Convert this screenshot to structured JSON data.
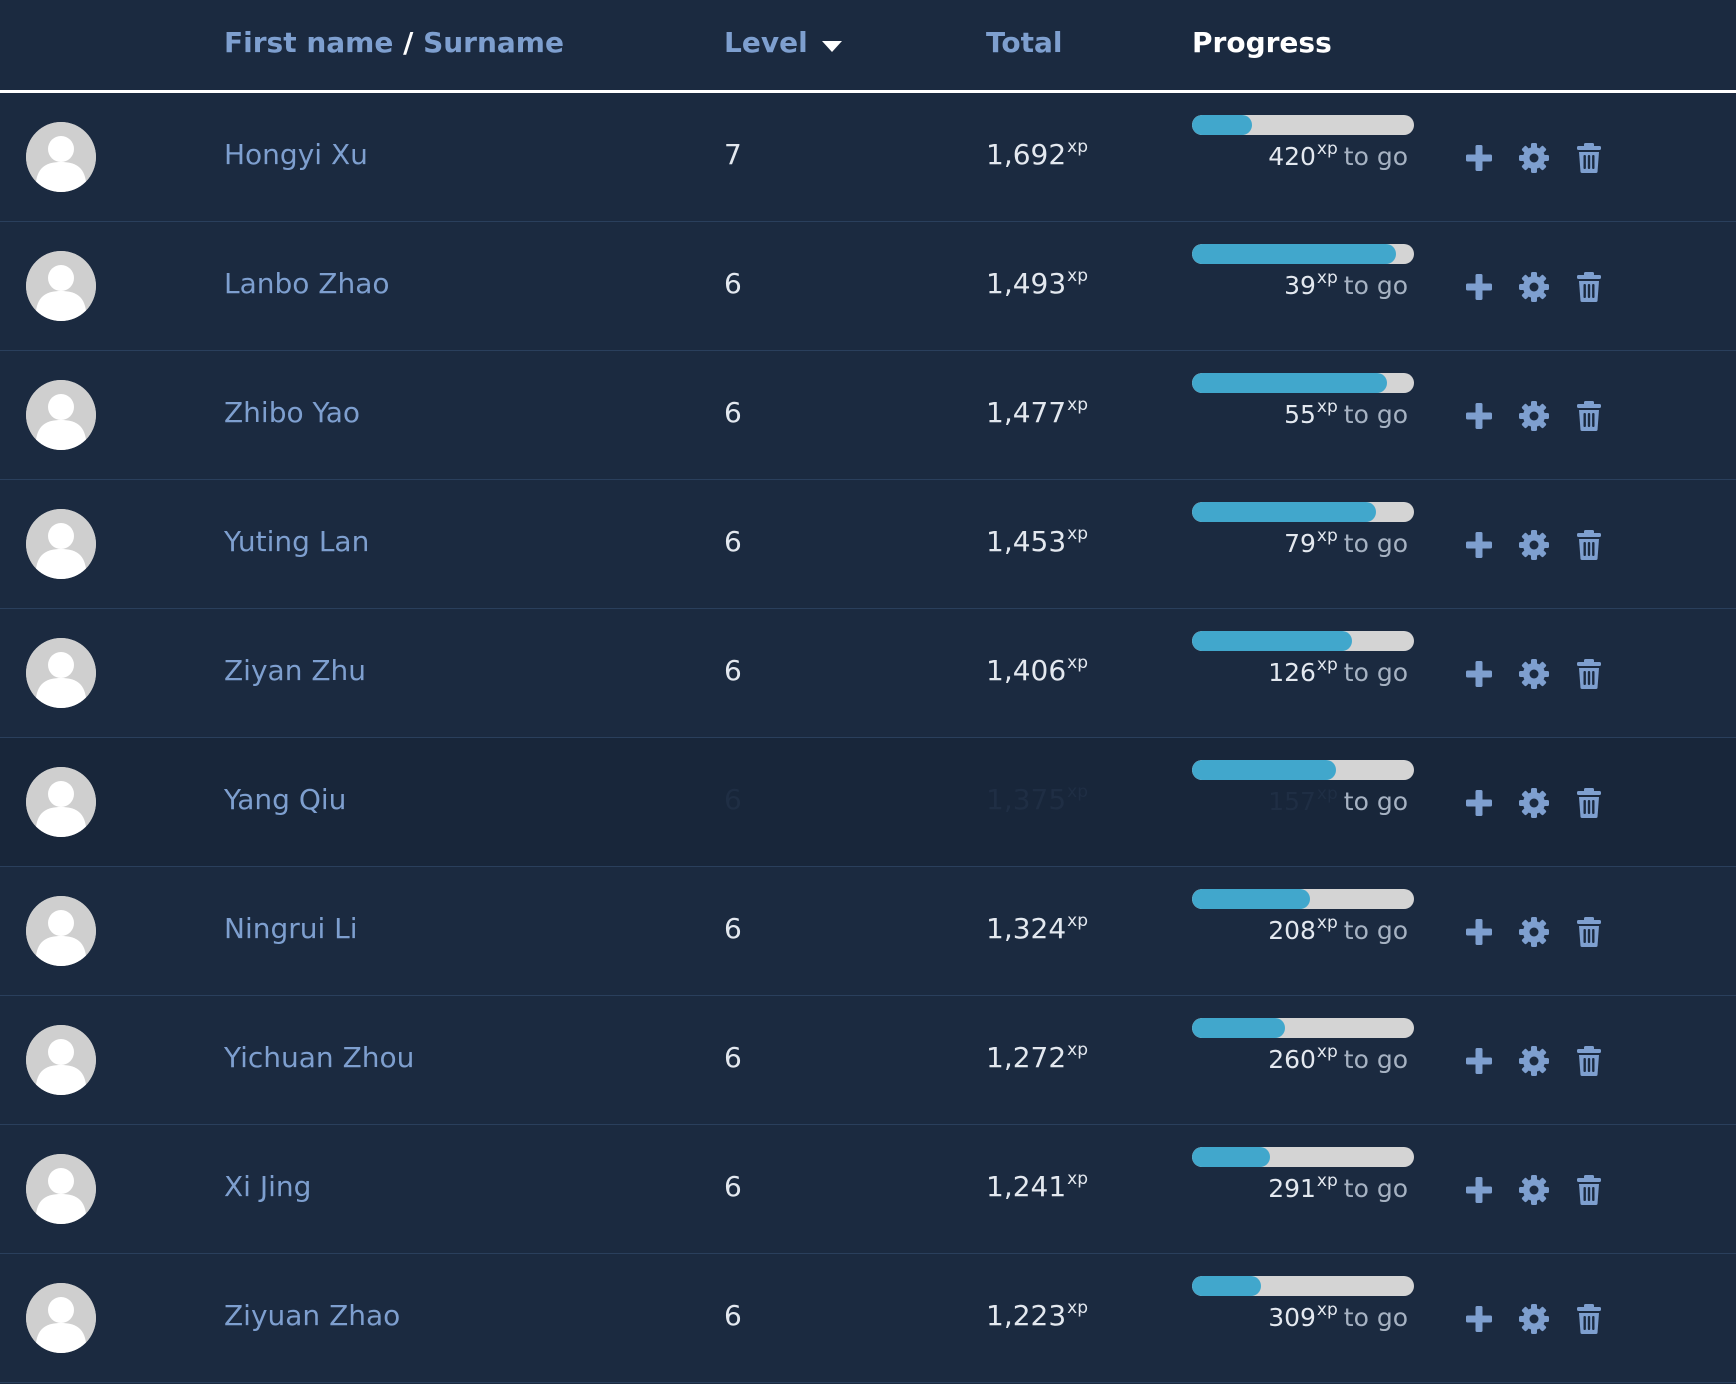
{
  "header": {
    "first_name": "First name",
    "slash": " / ",
    "surname": "Surname",
    "level": "Level",
    "total": "Total",
    "progress": "Progress"
  },
  "units": {
    "xp": "xp",
    "to_go": "to go"
  },
  "colors": {
    "background": "#1b2a40",
    "accent": "#7e9fcf",
    "bar_fill": "#41a7cc",
    "bar_track": "#d4d4d4"
  },
  "icons": {
    "sort": "caret-down-icon",
    "avatar": "user-avatar-icon",
    "add": "plus-icon",
    "settings": "gear-icon",
    "delete": "trash-icon"
  },
  "rows": [
    {
      "name": "Hongyi Xu",
      "level": "7",
      "total": "1,692",
      "remaining": "420",
      "progress": 0.27
    },
    {
      "name": "Lanbo Zhao",
      "level": "6",
      "total": "1,493",
      "remaining": "39",
      "progress": 0.92
    },
    {
      "name": "Zhibo Yao",
      "level": "6",
      "total": "1,477",
      "remaining": "55",
      "progress": 0.88
    },
    {
      "name": "Yuting Lan",
      "level": "6",
      "total": "1,453",
      "remaining": "79",
      "progress": 0.83
    },
    {
      "name": "Ziyan Zhu",
      "level": "6",
      "total": "1,406",
      "remaining": "126",
      "progress": 0.72
    },
    {
      "name": "Yang Qiu",
      "level": "6",
      "total": "1,375",
      "remaining": "157",
      "progress": 0.65,
      "dim": true
    },
    {
      "name": "Ningrui Li",
      "level": "6",
      "total": "1,324",
      "remaining": "208",
      "progress": 0.53
    },
    {
      "name": "Yichuan Zhou",
      "level": "6",
      "total": "1,272",
      "remaining": "260",
      "progress": 0.42
    },
    {
      "name": "Xi Jing",
      "level": "6",
      "total": "1,241",
      "remaining": "291",
      "progress": 0.35
    },
    {
      "name": "Ziyuan Zhao",
      "level": "6",
      "total": "1,223",
      "remaining": "309",
      "progress": 0.31
    }
  ]
}
